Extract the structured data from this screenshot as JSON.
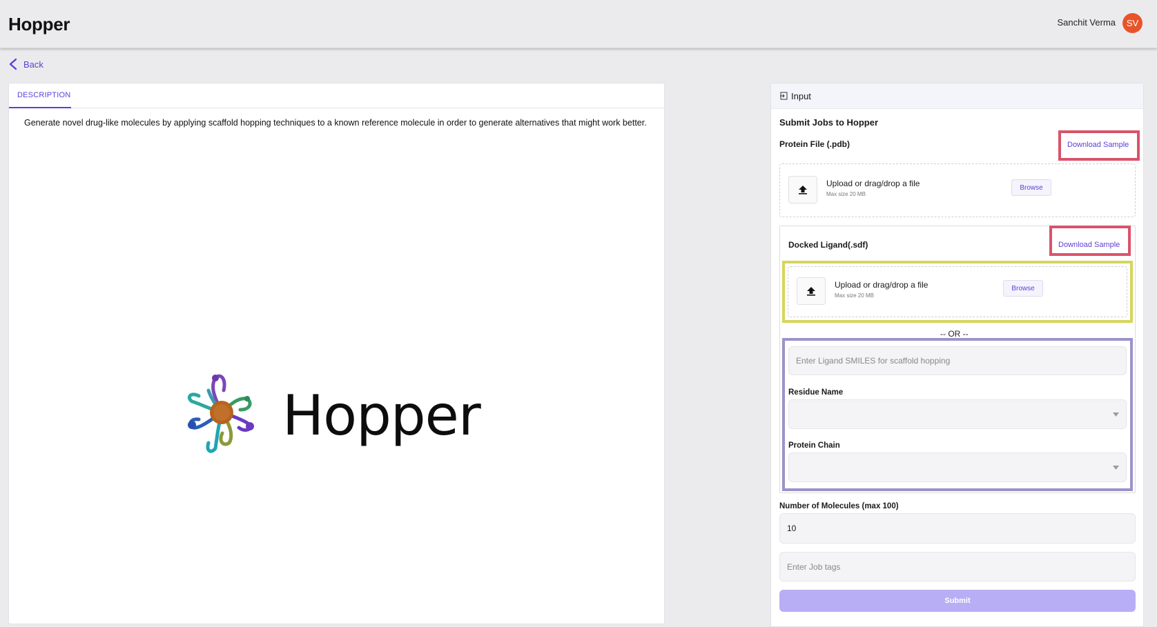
{
  "header": {
    "app_title": "Hopper",
    "user_name": "Sanchit Verma",
    "avatar_initials": "SV"
  },
  "nav": {
    "back_label": "Back"
  },
  "left_panel": {
    "tabs": [
      {
        "label": "DESCRIPTION",
        "active": true
      }
    ],
    "description": "Generate novel drug-like molecules by applying scaffold hopping techniques to a known reference molecule in order to generate alternatives that might work better.",
    "logo_text": "Hopper"
  },
  "right_panel": {
    "header_label": "Input",
    "header_icon": "login-icon",
    "form_title": "Submit Jobs to Hopper",
    "protein_file": {
      "label": "Protein File (.pdb)",
      "download_label": "Download Sample",
      "upload_title": "Upload or drag/drop a file",
      "upload_subtitle": "Max size 20 MB",
      "browse_label": "Browse"
    },
    "docked_ligand": {
      "label": "Docked Ligand(.sdf)",
      "download_label": "Download Sample",
      "upload_title": "Upload or drag/drop a file",
      "upload_subtitle": "Max size 20 MB",
      "browse_label": "Browse"
    },
    "or_divider": "-- OR --",
    "smiles": {
      "placeholder": "Enter Ligand SMILES for scaffold hopping"
    },
    "residue_name": {
      "label": "Residue Name",
      "value": ""
    },
    "protein_chain": {
      "label": "Protein Chain",
      "value": ""
    },
    "num_molecules": {
      "label": "Number of Molecules (max 100)",
      "value": "10"
    },
    "job_tags": {
      "placeholder": "Enter Job tags"
    },
    "submit_label": "Submit"
  },
  "colors": {
    "accent": "#5b3fd6",
    "avatar": "#e8542a",
    "submit_disabled": "#b8aef5",
    "highlight_red": "#d9536a",
    "highlight_yellow": "#d6d65a",
    "highlight_purple": "#9b93c8"
  }
}
